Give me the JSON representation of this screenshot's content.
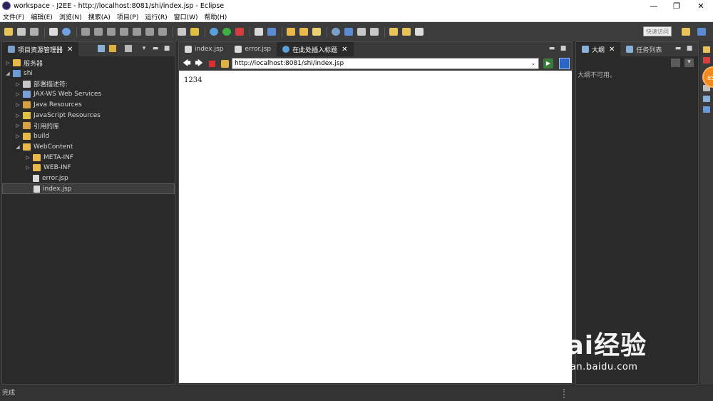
{
  "window": {
    "title": "workspace - J2EE - http://localhost:8081/shi/index.jsp - Eclipse",
    "controls": [
      "—",
      "❐",
      "✕"
    ]
  },
  "menu": [
    "文件(F)",
    "编辑(E)",
    "浏览(N)",
    "搜索(A)",
    "项目(P)",
    "运行(R)",
    "窗口(W)",
    "帮助(H)"
  ],
  "toolbar": {
    "quick_access": "快速访问"
  },
  "project_explorer": {
    "tab_label": "项目资源管理器",
    "tree": [
      {
        "label": "服务器",
        "depth": 0,
        "arrow": "▷",
        "icon": "folder-icon"
      },
      {
        "label": "shi",
        "depth": 0,
        "arrow": "◢",
        "icon": "project-icon"
      },
      {
        "label": "部署描述符:",
        "depth": 1,
        "arrow": "▷",
        "icon": "descriptor-icon"
      },
      {
        "label": "JAX-WS Web Services",
        "depth": 1,
        "arrow": "▷",
        "icon": "webservice-icon"
      },
      {
        "label": "Java Resources",
        "depth": 1,
        "arrow": "▷",
        "icon": "java-resources-icon"
      },
      {
        "label": "JavaScript Resources",
        "depth": 1,
        "arrow": "▷",
        "icon": "js-resources-icon"
      },
      {
        "label": "引用的库",
        "depth": 1,
        "arrow": "▷",
        "icon": "library-icon"
      },
      {
        "label": "build",
        "depth": 1,
        "arrow": "▷",
        "icon": "folder-icon"
      },
      {
        "label": "WebContent",
        "depth": 1,
        "arrow": "◢",
        "icon": "folder-icon"
      },
      {
        "label": "META-INF",
        "depth": 2,
        "arrow": "▷",
        "icon": "folder-icon"
      },
      {
        "label": "WEB-INF",
        "depth": 2,
        "arrow": "▷",
        "icon": "folder-icon"
      },
      {
        "label": "error.jsp",
        "depth": 2,
        "arrow": "",
        "icon": "file-icon"
      },
      {
        "label": "index.jsp",
        "depth": 2,
        "arrow": "",
        "icon": "file-icon",
        "selected": true
      }
    ]
  },
  "editor": {
    "tabs": [
      {
        "label": "index.jsp",
        "active": false
      },
      {
        "label": "error.jsp",
        "active": false
      },
      {
        "label": "在此处插入标题",
        "active": true
      }
    ],
    "url": "http://localhost:8081/shi/index.jsp",
    "content": "1234"
  },
  "outline": {
    "tabs": [
      {
        "label": "大纲",
        "active": true
      },
      {
        "label": "任务列表",
        "active": false
      }
    ],
    "message": "大纲不可用。"
  },
  "status": {
    "text": "完成"
  },
  "badge": {
    "text": "85"
  },
  "watermark": {
    "main": "Bai经验",
    "sub": "jingyan.baidu.com"
  }
}
